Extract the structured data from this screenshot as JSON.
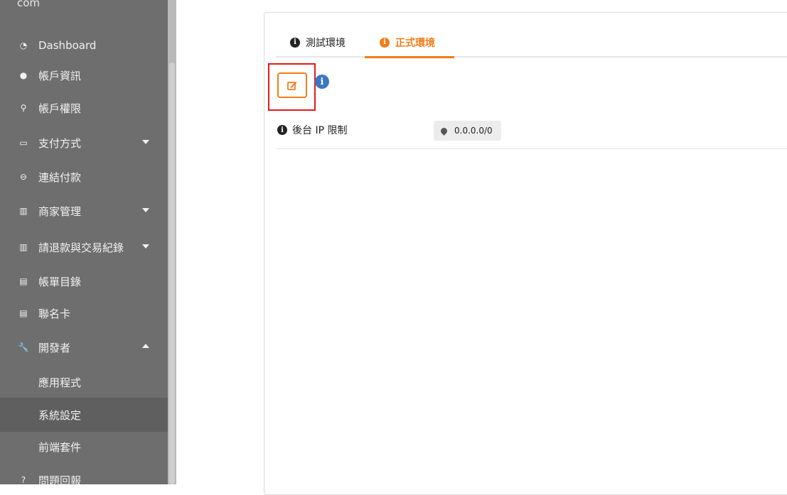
{
  "sidebar": {
    "brand_fragment": "com",
    "items": [
      {
        "label": "Dashboard",
        "icon": "dashboard-icon",
        "glyph": "◔"
      },
      {
        "label": "帳戶資訊",
        "icon": "info-icon",
        "glyph": "●"
      },
      {
        "label": "帳戶權限",
        "icon": "user-check-icon",
        "glyph": "⚲"
      },
      {
        "label": "支付方式",
        "icon": "credit-card-icon",
        "glyph": "▭"
      },
      {
        "label": "連結付款",
        "icon": "link-icon",
        "glyph": "⊖"
      },
      {
        "label": "商家管理",
        "icon": "store-icon",
        "glyph": "▥"
      },
      {
        "label": "請退款與交易紀錄",
        "icon": "records-icon",
        "glyph": "▥"
      },
      {
        "label": "帳單目錄",
        "icon": "list-icon",
        "glyph": "▤"
      },
      {
        "label": "聯名卡",
        "icon": "list-icon",
        "glyph": "▤"
      },
      {
        "label": "開發者",
        "icon": "wrench-icon",
        "glyph": "🔧"
      },
      {
        "label": "應用程式"
      },
      {
        "label": "系統設定"
      },
      {
        "label": "前端套件"
      },
      {
        "label": "問題回報",
        "icon": "question-icon",
        "glyph": "?"
      }
    ]
  },
  "tabs": [
    {
      "label": "測試環境",
      "icon": "info-icon"
    },
    {
      "label": "正式環境",
      "icon": "info-icon"
    }
  ],
  "active_tab": "正式環境",
  "colors": {
    "accent": "#f07d1a",
    "highlight": "#e01b1b",
    "info_blue": "#3b78c4",
    "sidebar_bg": "#6e6e6e"
  },
  "settings": {
    "ip_label": "後台 IP 限制",
    "ip_value": "0.0.0.0/0"
  },
  "info_glyph": "i"
}
